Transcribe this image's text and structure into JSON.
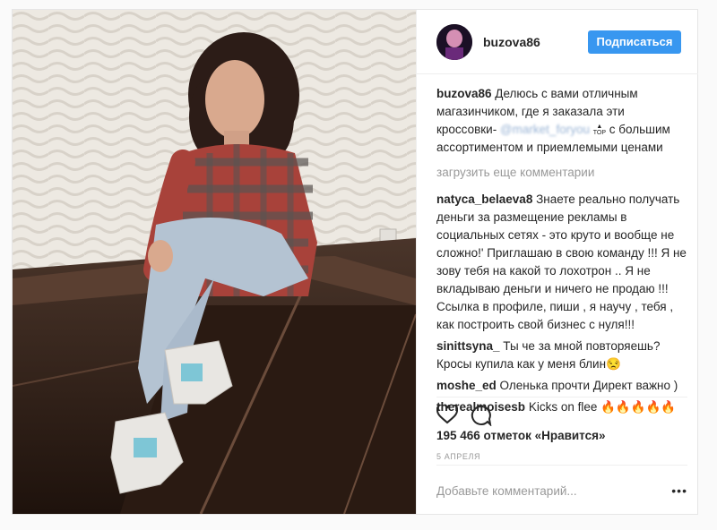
{
  "post": {
    "username": "buzova86",
    "follow_label": "Подписаться",
    "caption": {
      "user": "buzova86",
      "text_before": "Делюсь с вами отличным магазинчиком, где я заказала эти кроссовки-",
      "mention": "@market_foryou",
      "badge": "TOP",
      "text_after": "с большим ассортиментом и приемлемыми ценами"
    },
    "load_more": "загрузить еще комментарии",
    "comments": [
      {
        "user": "natyca_belaeva8",
        "text": "Знаете реально получать деньги за размещение рекламы в социальных сетях - это круто и вообще не сложно!' Приглашаю в свою команду !!! Я не зову тебя на какой то лохотрон .. Я не вкладываю деньги и ничего не продаю !!! Ссылка в профиле, пиши , я научу , тебя , как построить свой бизнес с нуля!!!"
      },
      {
        "user": "sinittsyna_",
        "text": "Ты че за мной повторяешь? Кросы купила как у меня блин😒"
      },
      {
        "user": "moshe_ed",
        "text": "Оленька прочти Директ важно )"
      },
      {
        "user": "therealmoisesb",
        "text": "Kicks on flee 🔥🔥🔥🔥🔥"
      }
    ],
    "likes": "195 466 отметок «Нравится»",
    "date": "5 АПРЕЛЯ",
    "add_comment_placeholder": "Добавьте комментарий...",
    "more_options": "•••",
    "icons": {
      "like": "heart-icon",
      "comment": "comment-icon",
      "more": "more-options-icon"
    },
    "colors": {
      "accent": "#3897f0",
      "text": "#262626",
      "muted": "#999999",
      "border": "#efefef"
    }
  }
}
